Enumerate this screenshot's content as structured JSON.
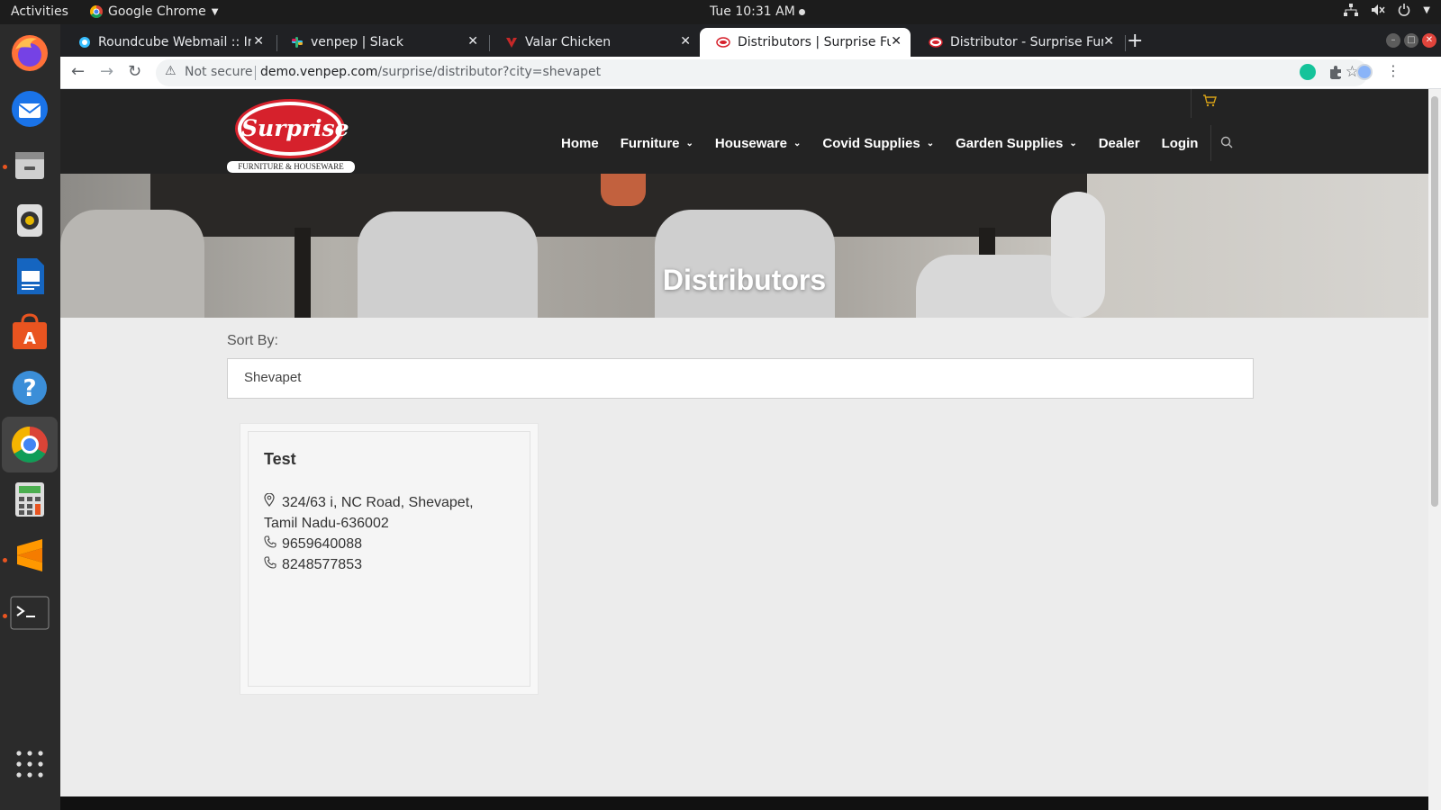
{
  "topbar": {
    "activities": "Activities",
    "app_name": "Google Chrome",
    "clock": "Tue 10:31 AM"
  },
  "dock": {
    "items": [
      "Firefox",
      "Thunderbird",
      "Files",
      "Rhythmbox",
      "LibreOffice Writer",
      "Ubuntu Software",
      "Help",
      "Google Chrome",
      "Calculator",
      "Sublime Text",
      "Terminal",
      "Show Applications"
    ]
  },
  "browser": {
    "tabs": [
      {
        "title": "Roundcube Webmail :: Inbox",
        "active": false
      },
      {
        "title": "venpep | Slack",
        "active": false
      },
      {
        "title": "Valar Chicken",
        "active": false
      },
      {
        "title": "Distributors | Surprise Furniture",
        "active": true
      },
      {
        "title": "Distributor - Surprise Furniture",
        "active": false
      }
    ],
    "new_tab": "+",
    "security_label": "Not secure",
    "url_host": "demo.venpep.com",
    "url_path": "/surprise/distributor?city=shevapet"
  },
  "site": {
    "logo_text": "Surprise",
    "logo_tagline": "FURNITURE & HOUSEWARE",
    "nav": [
      {
        "label": "Home",
        "dropdown": false
      },
      {
        "label": "Furniture",
        "dropdown": true
      },
      {
        "label": "Houseware",
        "dropdown": true
      },
      {
        "label": "Covid Supplies",
        "dropdown": true
      },
      {
        "label": "Garden Supplies",
        "dropdown": true
      },
      {
        "label": "Dealer",
        "dropdown": false
      },
      {
        "label": "Login",
        "dropdown": false
      }
    ],
    "hero_title": "Distributors",
    "sort_label": "Sort By:",
    "selected_city": "Shevapet",
    "distributor": {
      "name": "Test",
      "address_line1": "324/63 i, NC Road, Shevapet,",
      "address_line2": "Tamil Nadu-636002",
      "phone1": "9659640088",
      "phone2": "8248577853"
    }
  },
  "colors": {
    "header_bg": "#232323",
    "brand_red": "#d6212c",
    "cart_gold": "#d4a017",
    "page_bg": "#ececec"
  }
}
